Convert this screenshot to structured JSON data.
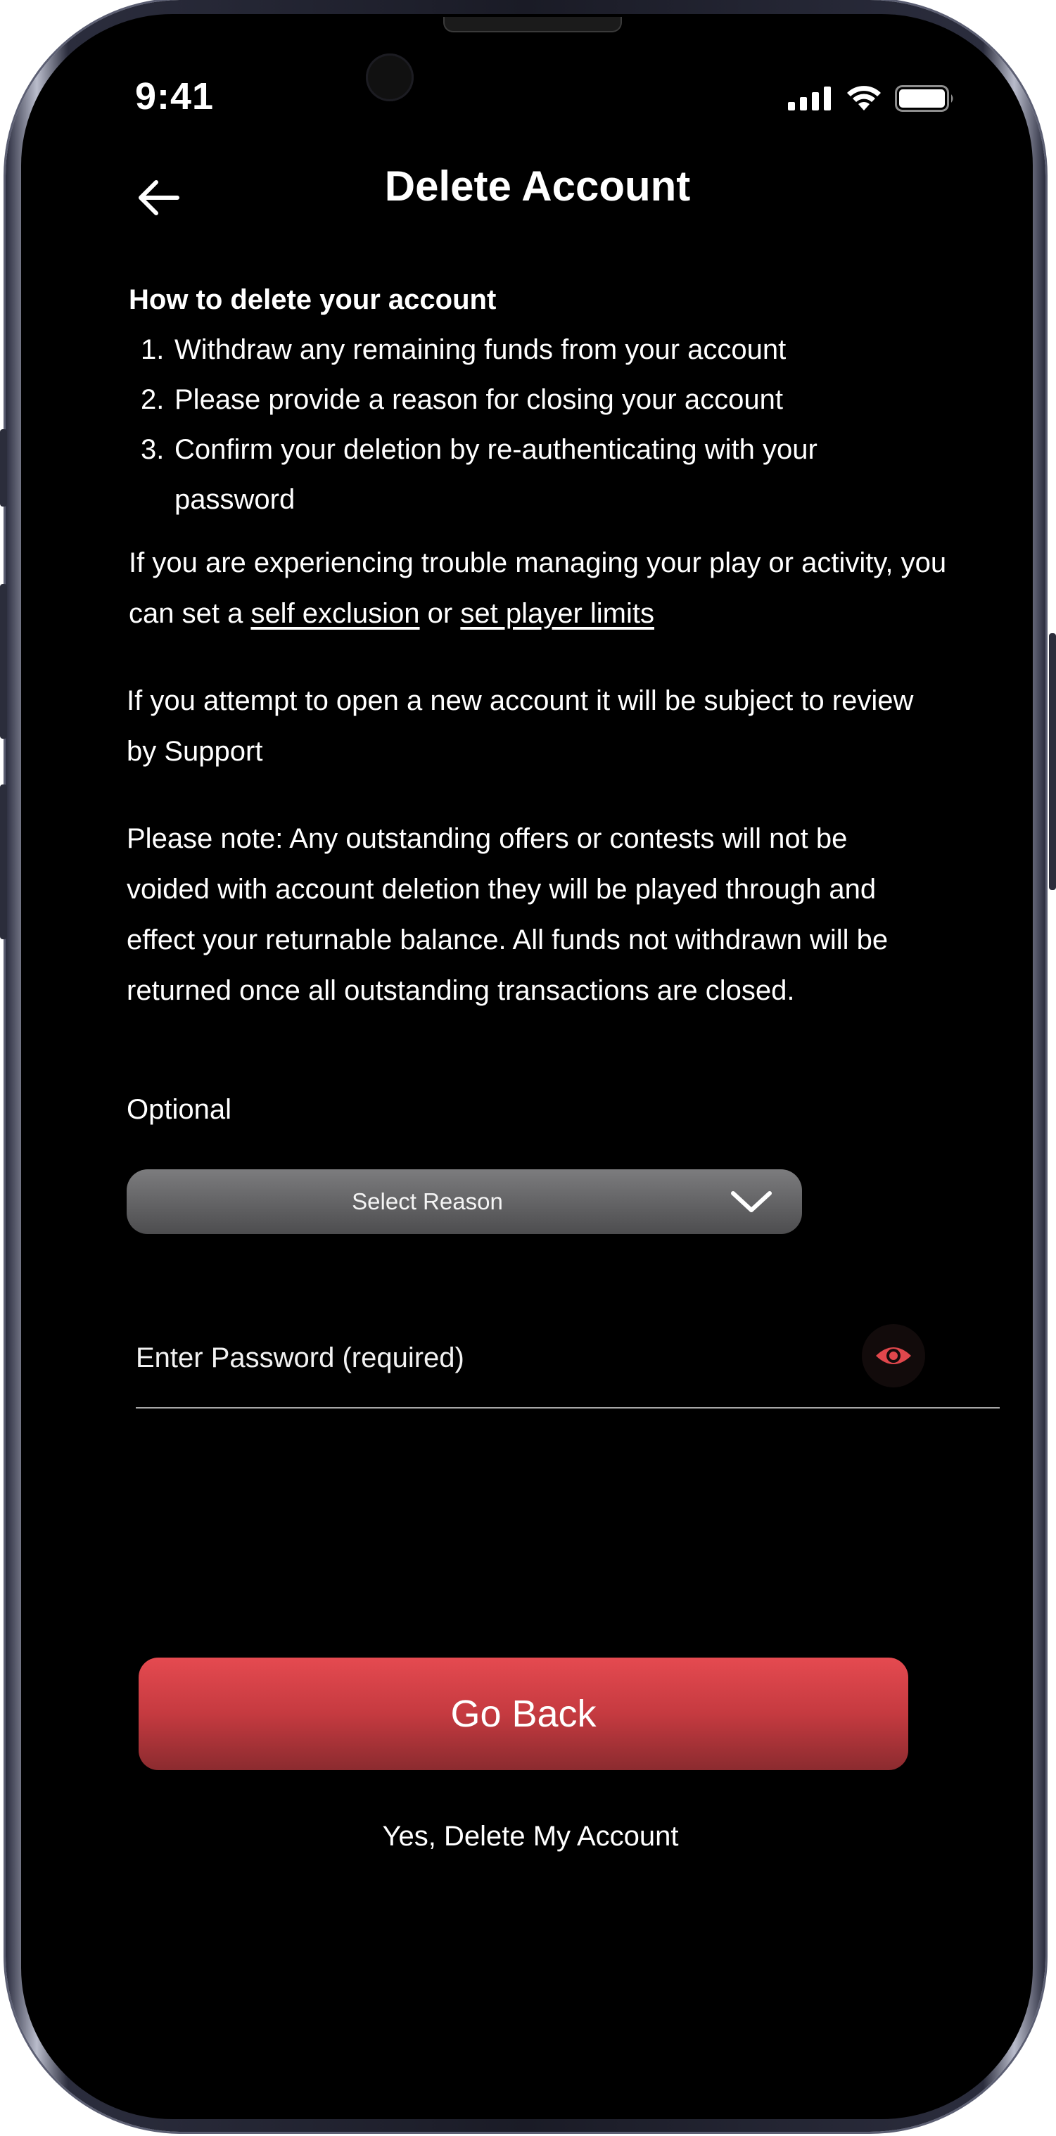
{
  "status_bar": {
    "time": "9:41"
  },
  "header": {
    "title": "Delete Account",
    "back_icon": "arrow-left-icon"
  },
  "instructions": {
    "heading": "How to delete your account",
    "steps": [
      {
        "num": "1.",
        "text": "Withdraw any remaining funds from your account"
      },
      {
        "num": "2.",
        "text": "Please provide a reason for closing your account"
      },
      {
        "num": "3.",
        "text": "Confirm your deletion by re-authenticating with your password"
      }
    ]
  },
  "trouble": {
    "text_before": "If you are experiencing trouble managing your play or activity, you can set a ",
    "self_exclusion_link": "self exclusion",
    "or_text": " or ",
    "player_limits_link": "set player limits"
  },
  "review_note": "If you attempt to open a new account it will be subject to review by Support",
  "please_note": "Please note: Any outstanding offers or contests will not be voided with account deletion they will be played through and effect your returnable balance. All funds not withdrawn will be returned once all outstanding transactions are closed.",
  "reason": {
    "label": "Optional",
    "select_value": "Select Reason"
  },
  "password": {
    "placeholder": "Enter Password (required)",
    "toggle_icon": "eye-icon"
  },
  "actions": {
    "go_back": "Go Back",
    "delete": "Yes, Delete My Account"
  },
  "colors": {
    "accent": "#E0474C",
    "background": "#000000"
  }
}
